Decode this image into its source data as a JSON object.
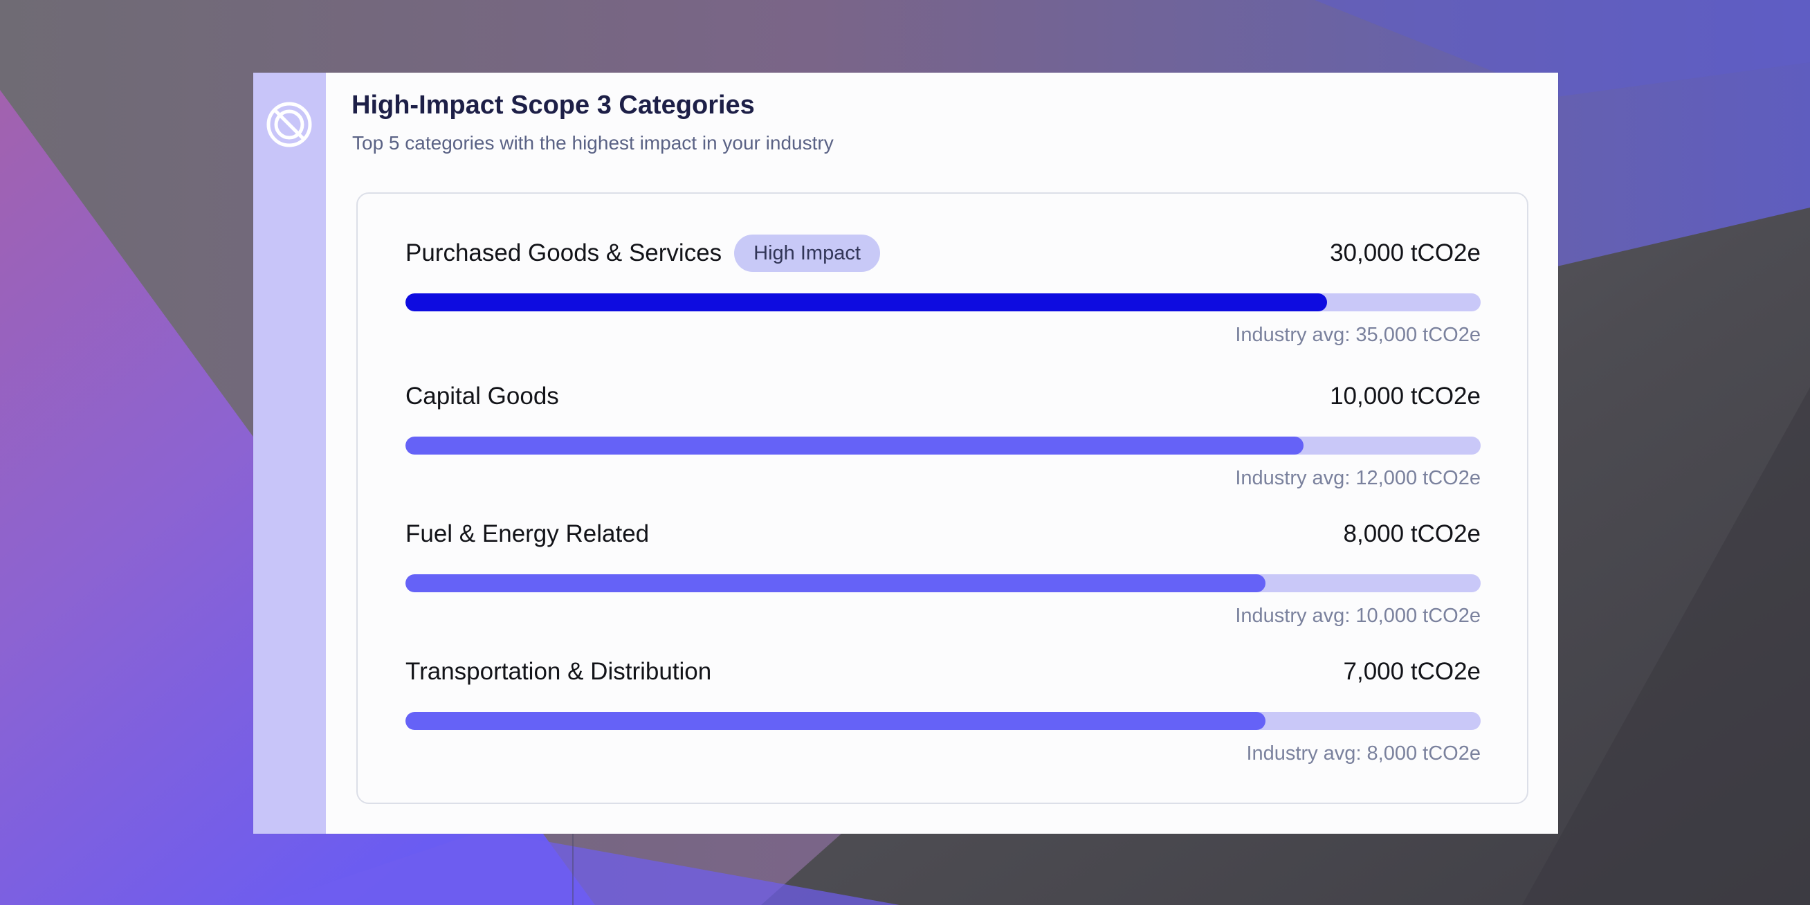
{
  "page": {
    "title": "High-Impact Scope 3 Categories",
    "subtitle": "Top 5 categories with the highest impact in your industry"
  },
  "brand": {
    "logo_icon": "circle-slash-logo-icon"
  },
  "colors": {
    "accent_strong": "#0e0ce0",
    "accent": "#6562f7",
    "track": "#c9c8f8",
    "badge_bg": "#c8c9f7"
  },
  "categories": [
    {
      "label": "Purchased Goods & Services",
      "badge": "High Impact",
      "value": "30,000 tCO2e",
      "avg": "Industry avg: 35,000 tCO2e",
      "ratio": 0.857,
      "emphasis": true
    },
    {
      "label": "Capital Goods",
      "badge": "",
      "value": "10,000 tCO2e",
      "avg": "Industry avg: 12,000 tCO2e",
      "ratio": 0.835,
      "emphasis": false
    },
    {
      "label": "Fuel & Energy Related",
      "badge": "",
      "value": "8,000 tCO2e",
      "avg": "Industry avg: 10,000 tCO2e",
      "ratio": 0.8,
      "emphasis": false
    },
    {
      "label": "Transportation & Distribution",
      "badge": "",
      "value": "7,000 tCO2e",
      "avg": "Industry avg: 8,000 tCO2e",
      "ratio": 0.8,
      "emphasis": false
    }
  ]
}
